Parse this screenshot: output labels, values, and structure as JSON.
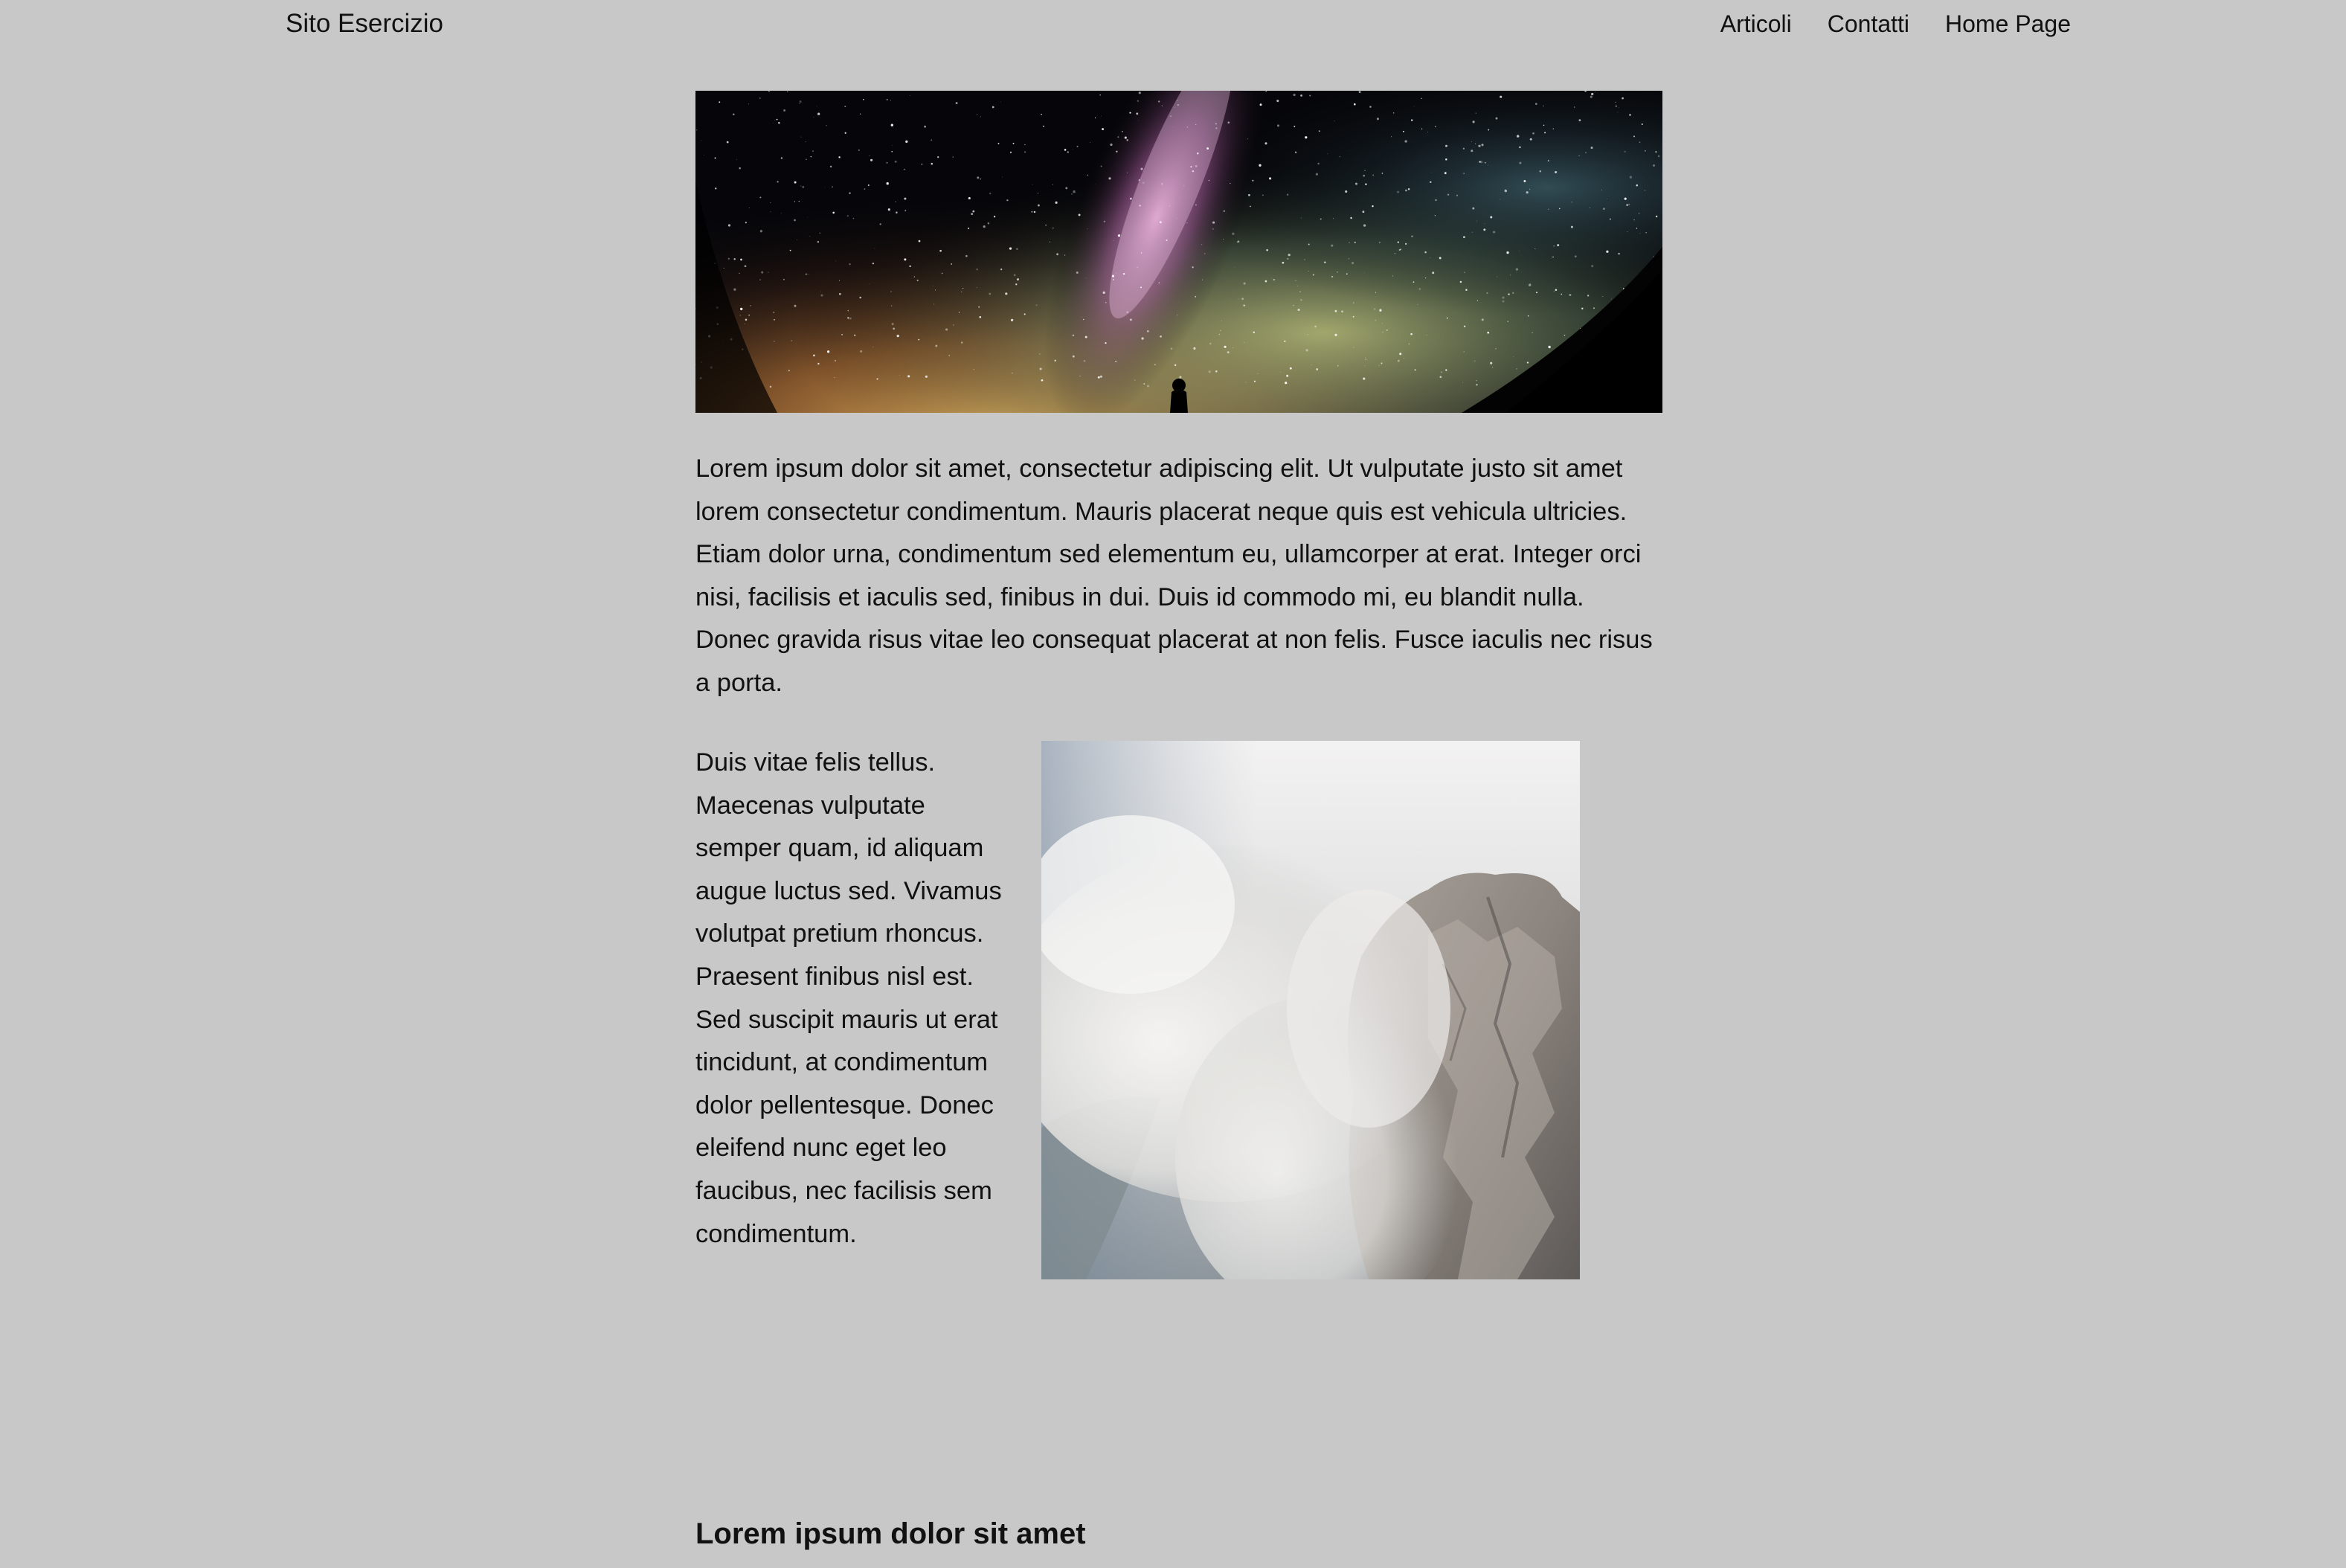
{
  "header": {
    "site_title": "Sito Esercizio",
    "nav": [
      {
        "label": "Articoli"
      },
      {
        "label": "Contatti"
      },
      {
        "label": "Home Page"
      }
    ]
  },
  "main": {
    "intro_paragraph": "Lorem ipsum dolor sit amet, consectetur adipiscing elit. Ut vulputate justo sit amet lorem consectetur condimentum. Mauris placerat neque quis est vehicula ultricies. Etiam dolor urna, condimentum sed elementum eu, ullamcorper at erat. Integer orci nisi, facilisis et iaculis sed, finibus in dui. Duis id commodo mi, eu blandit nulla. Donec gravida risus vitae leo consequat placerat at non felis. Fusce iaculis nec risus a porta.",
    "side_paragraph": "Duis vitae felis tellus. Maecenas vulputate semper quam, id aliquam augue luctus sed. Vivamus volutpat pretium rhoncus. Praesent finibus nisl est. Sed suscipit mauris ut erat tincidunt, at condimentum dolor pellentesque. Donec eleifend nunc eget leo faucibus, nec facilisis sem condimentum.",
    "section_heading": "Lorem ipsum dolor sit amet"
  },
  "colors": {
    "page_background": "#c8c8c8",
    "text": "#111111"
  }
}
